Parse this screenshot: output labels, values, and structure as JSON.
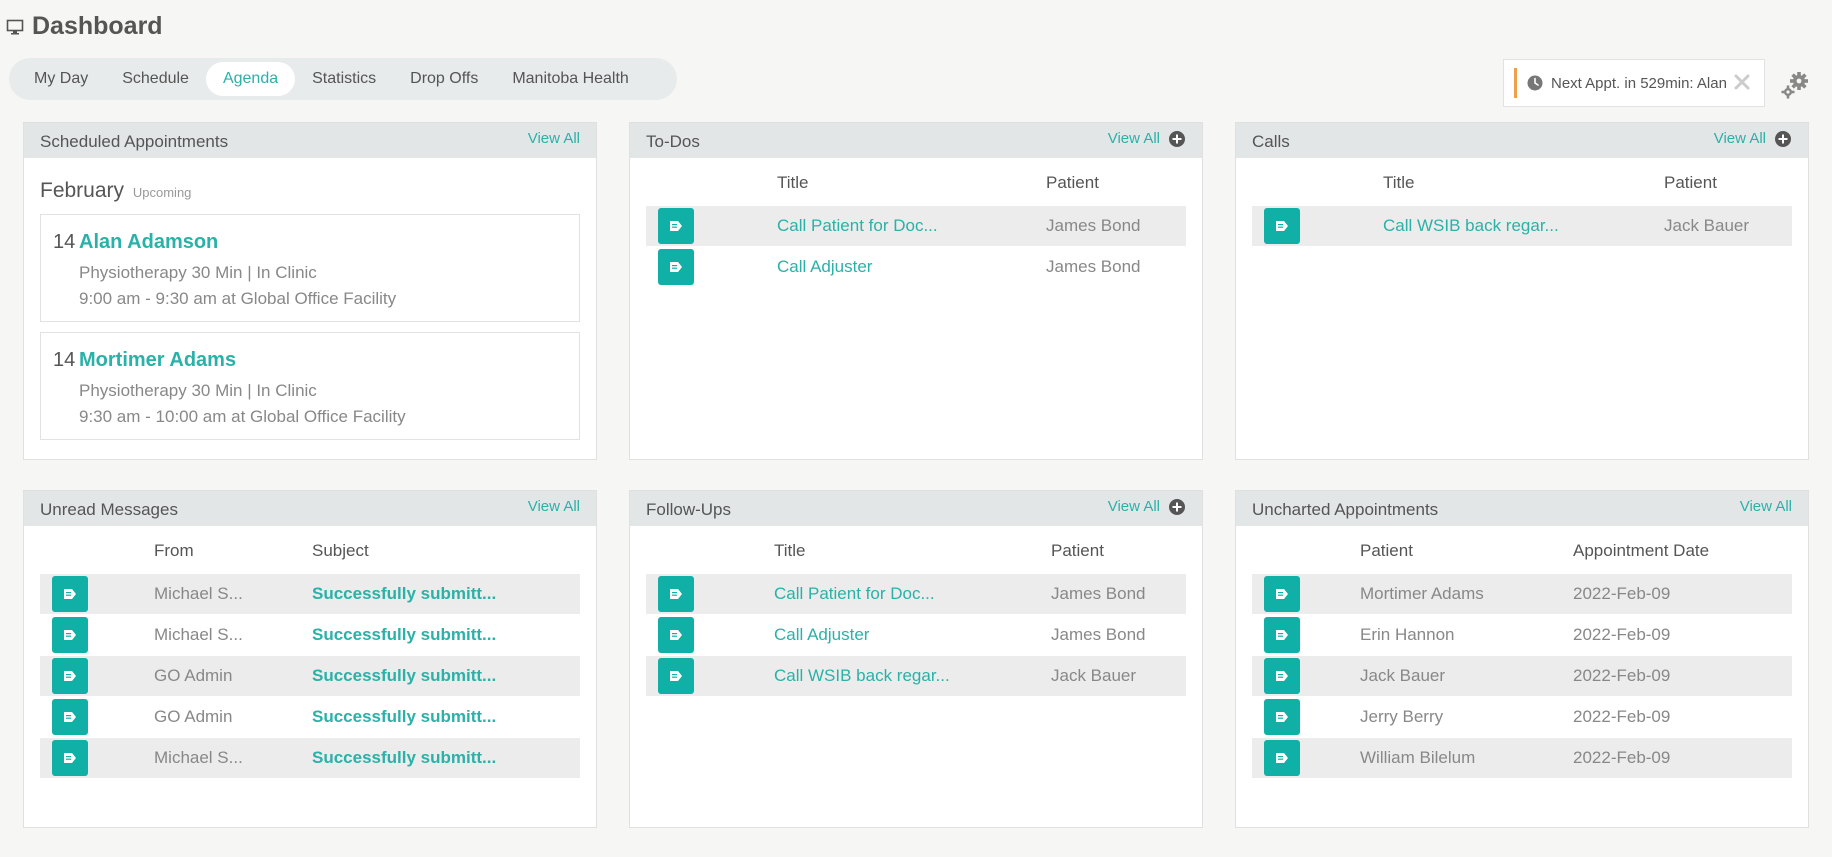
{
  "header": {
    "title": "Dashboard",
    "icon": "monitor-icon"
  },
  "tabs": [
    {
      "label": "My Day",
      "active": false
    },
    {
      "label": "Schedule",
      "active": false
    },
    {
      "label": "Agenda",
      "active": true
    },
    {
      "label": "Statistics",
      "active": false
    },
    {
      "label": "Drop Offs",
      "active": false
    },
    {
      "label": "Manitoba Health",
      "active": false
    }
  ],
  "next_appt": {
    "text": "Next Appt. in 529min: Alan"
  },
  "colors": {
    "accent": "#2ab1a8",
    "button": "#10b0a6",
    "notice_bar": "#f0a04b"
  },
  "scheduled": {
    "title": "Scheduled Appointments",
    "view_all": "View All",
    "month": "February",
    "month_sub": "Upcoming",
    "items": [
      {
        "day": "14",
        "name": "Alan Adamson",
        "line1": "Physiotherapy 30 Min | In Clinic",
        "line2": "9:00 am - 9:30 am at Global Office Facility"
      },
      {
        "day": "14",
        "name": "Mortimer Adams",
        "line1": "Physiotherapy 30 Min | In Clinic",
        "line2": "9:30 am - 10:00 am at Global Office Facility"
      }
    ]
  },
  "todos": {
    "title": "To-Dos",
    "view_all": "View All",
    "columns": [
      "Title",
      "Patient"
    ],
    "rows": [
      {
        "title": "Call Patient for Doc...",
        "patient": "James Bond"
      },
      {
        "title": "Call Adjuster",
        "patient": "James Bond"
      }
    ]
  },
  "calls": {
    "title": "Calls",
    "view_all": "View All",
    "columns": [
      "Title",
      "Patient"
    ],
    "rows": [
      {
        "title": "Call WSIB back regar...",
        "patient": "Jack Bauer"
      }
    ]
  },
  "messages": {
    "title": "Unread Messages",
    "view_all": "View All",
    "columns": [
      "From",
      "Subject"
    ],
    "rows": [
      {
        "from": "Michael S...",
        "subject": "Successfully submitt..."
      },
      {
        "from": "Michael S...",
        "subject": "Successfully submitt..."
      },
      {
        "from": "GO Admin",
        "subject": "Successfully submitt..."
      },
      {
        "from": "GO Admin",
        "subject": "Successfully submitt..."
      },
      {
        "from": "Michael S...",
        "subject": "Successfully submitt..."
      }
    ]
  },
  "followups": {
    "title": "Follow-Ups",
    "view_all": "View All",
    "columns": [
      "Title",
      "Patient"
    ],
    "rows": [
      {
        "title": "Call Patient for Doc...",
        "patient": "James Bond"
      },
      {
        "title": "Call Adjuster",
        "patient": "James Bond"
      },
      {
        "title": "Call WSIB back regar...",
        "patient": "Jack Bauer"
      }
    ]
  },
  "uncharted": {
    "title": "Uncharted Appointments",
    "view_all": "View All",
    "columns": [
      "Patient",
      "Appointment Date"
    ],
    "rows": [
      {
        "patient": "Mortimer Adams",
        "date": "2022-Feb-09"
      },
      {
        "patient": "Erin Hannon",
        "date": "2022-Feb-09"
      },
      {
        "patient": "Jack Bauer",
        "date": "2022-Feb-09"
      },
      {
        "patient": "Jerry Berry",
        "date": "2022-Feb-09"
      },
      {
        "patient": "William Bilelum",
        "date": "2022-Feb-09"
      }
    ]
  }
}
